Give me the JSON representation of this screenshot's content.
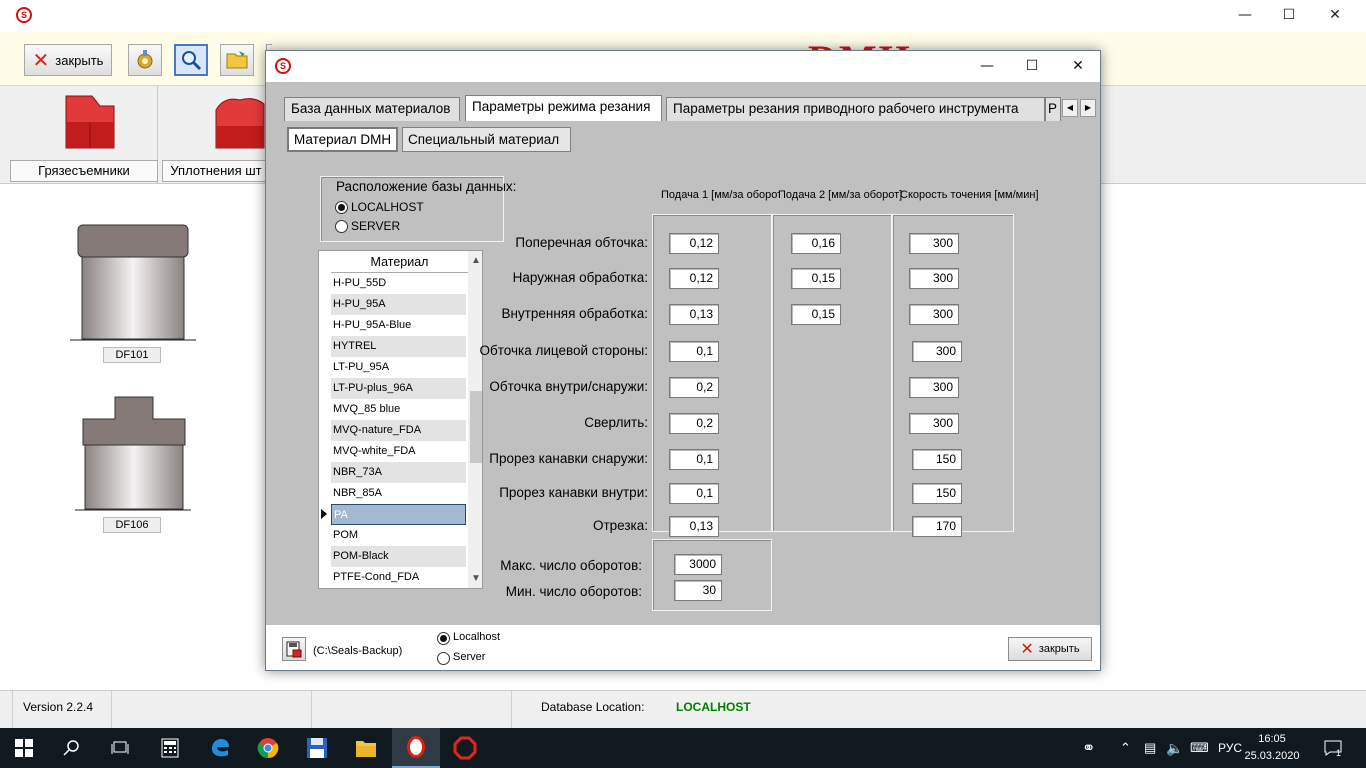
{
  "main": {
    "close_label": "закрыть",
    "brand_text": "DMH",
    "categories": [
      {
        "label": "Грязесъемники"
      },
      {
        "label": "Уплотнения шт"
      }
    ],
    "parts": [
      {
        "label": "DF101"
      },
      {
        "label": "DF106"
      }
    ]
  },
  "status": {
    "version": "Version 2.2.4",
    "db_location_label": "Database Location:",
    "db_location_value": "LOCALHOST",
    "db_location_color": "#008000"
  },
  "dialog": {
    "tabs": [
      {
        "label": "База данных материалов"
      },
      {
        "label": "Параметры режима резания"
      },
      {
        "label": "Параметры резания приводного рабочего инструмента"
      },
      {
        "label": "Р"
      }
    ],
    "active_tab": 1,
    "subtabs": [
      {
        "label": "Материал DMH"
      },
      {
        "label": "Специальный материал"
      }
    ],
    "db_location": {
      "title": "Расположение базы данных:",
      "options": [
        {
          "label": "LOCALHOST",
          "selected": true
        },
        {
          "label": "SERVER",
          "selected": false
        }
      ]
    },
    "material_grid": {
      "header": "Материал",
      "rows": [
        {
          "name": "H-PU_55D"
        },
        {
          "name": "H-PU_95A"
        },
        {
          "name": "H-PU_95A-Blue"
        },
        {
          "name": "HYTREL"
        },
        {
          "name": "LT-PU_95A"
        },
        {
          "name": "LT-PU-plus_96A"
        },
        {
          "name": "MVQ_85 blue"
        },
        {
          "name": "MVQ-nature_FDA"
        },
        {
          "name": "MVQ-white_FDA"
        },
        {
          "name": "NBR_73A"
        },
        {
          "name": "NBR_85A"
        },
        {
          "name": "PA"
        },
        {
          "name": "POM"
        },
        {
          "name": "POM-Black"
        },
        {
          "name": "PTFE-Cond_FDA"
        }
      ],
      "selected_index": 11
    },
    "columns": {
      "feed1": "Подача 1 [мм/за оборот]",
      "feed2": "Подача 2 [мм/за оборот]",
      "speed": "Скорость точения [мм/мин]"
    },
    "operations": [
      {
        "label": "Поперечная обточка:",
        "feed1": "0,12",
        "feed2": "0,16",
        "speed": "300"
      },
      {
        "label": "Наружная обработка:",
        "feed1": "0,12",
        "feed2": "0,15",
        "speed": "300"
      },
      {
        "label": "Внутренняя обработка:",
        "feed1": "0,13",
        "feed2": "0,15",
        "speed": "300"
      },
      {
        "label": "Обточка лицевой стороны:",
        "feed1": "0,1",
        "feed2": null,
        "speed": "300"
      },
      {
        "label": "Обточка внутри/снаружи:",
        "feed1": "0,2",
        "feed2": null,
        "speed": "300"
      },
      {
        "label": "Сверлить:",
        "feed1": "0,2",
        "feed2": null,
        "speed": "300"
      },
      {
        "label": "Прорез канавки снаружи:",
        "feed1": "0,1",
        "feed2": null,
        "speed": "150"
      },
      {
        "label": "Прорез канавки внутри:",
        "feed1": "0,1",
        "feed2": null,
        "speed": "150"
      },
      {
        "label": "Отрезка:",
        "feed1": "0,13",
        "feed2": null,
        "speed": "170"
      }
    ],
    "rpm": {
      "max_label": "Макс. число оборотов:",
      "max_value": "3000",
      "min_label": "Мин. число оборотов:",
      "min_value": "30"
    },
    "bottom": {
      "backup_path": "(C:\\Seals-Backup)",
      "targets": [
        {
          "label": "Localhost",
          "selected": true
        },
        {
          "label": "Server",
          "selected": false
        }
      ],
      "close_label": "закрыть"
    }
  },
  "taskbar": {
    "lang": "РУС",
    "time": "16:05",
    "date": "25.03.2020",
    "notifications": "1"
  }
}
